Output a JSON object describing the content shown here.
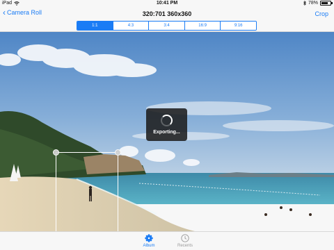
{
  "status_bar": {
    "device": "iPad",
    "time": "10:41 PM",
    "battery_label": "78%",
    "battery_level": 0.78
  },
  "nav": {
    "back_label": "Camera Roll",
    "title": "320:701 360x360",
    "action_label": "Crop"
  },
  "ratios": {
    "items": [
      "1:1",
      "4:3",
      "3:4",
      "16:9",
      "9:16"
    ],
    "selected": "1:1"
  },
  "hud": {
    "label": "Exporting..."
  },
  "tabs": {
    "album": "Album",
    "recents": "Recents"
  },
  "colors": {
    "accent": "#1a7cf5",
    "inactive": "#9a9a9a"
  },
  "icons": [
    "back-chevron-icon",
    "wifi-icon",
    "bluetooth-icon",
    "battery-icon",
    "spinner-icon",
    "flower-icon",
    "clock-icon"
  ]
}
